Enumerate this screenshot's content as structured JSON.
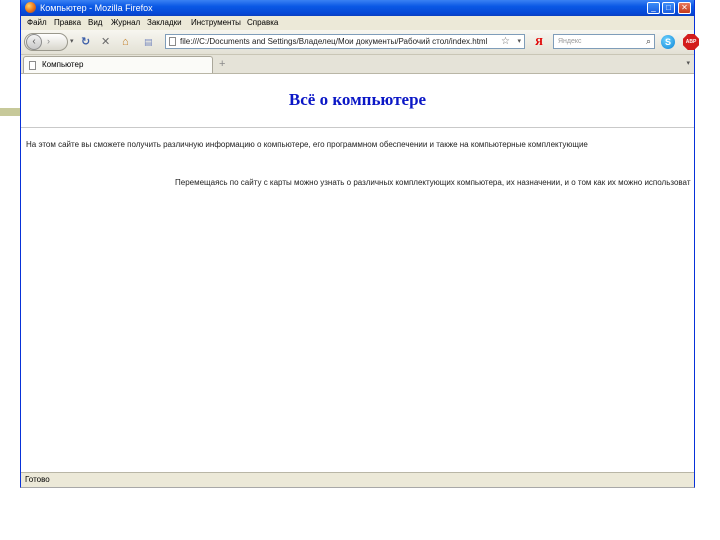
{
  "window": {
    "title": "Компьютер - Mozilla Firefox",
    "controls": {
      "minimize": "_",
      "maximize": "□",
      "close": "✕"
    }
  },
  "menu": [
    "Файл",
    "Правка",
    "Вид",
    "Журнал",
    "Закладки",
    "Инструменты",
    "Справка"
  ],
  "nav": {
    "url": "file:///C:/Documents and Settings/Владелец/Мои документы/Рабочий стол/index.html",
    "search_placeholder": "Яндекс",
    "search_engine_letter": "Я",
    "abp_label": "ABP"
  },
  "tabs": [
    {
      "label": "Компьютер"
    }
  ],
  "page": {
    "heading": "Всё о компьютере",
    "intro": "На этом сайте вы сможете получить различную информацию о компьютере, его программном обеспечении и также на компьютерные комплектующие",
    "second": "Перемещаясь по сайту с карты можно узнать о различных комплектующих компьютера, их назначении, и о том как их можно использовать"
  },
  "status": {
    "text": "Готово"
  },
  "colors": {
    "heading": "#0b17c6",
    "titlebar": "#0a58e5",
    "chrome": "#ece9d8"
  }
}
